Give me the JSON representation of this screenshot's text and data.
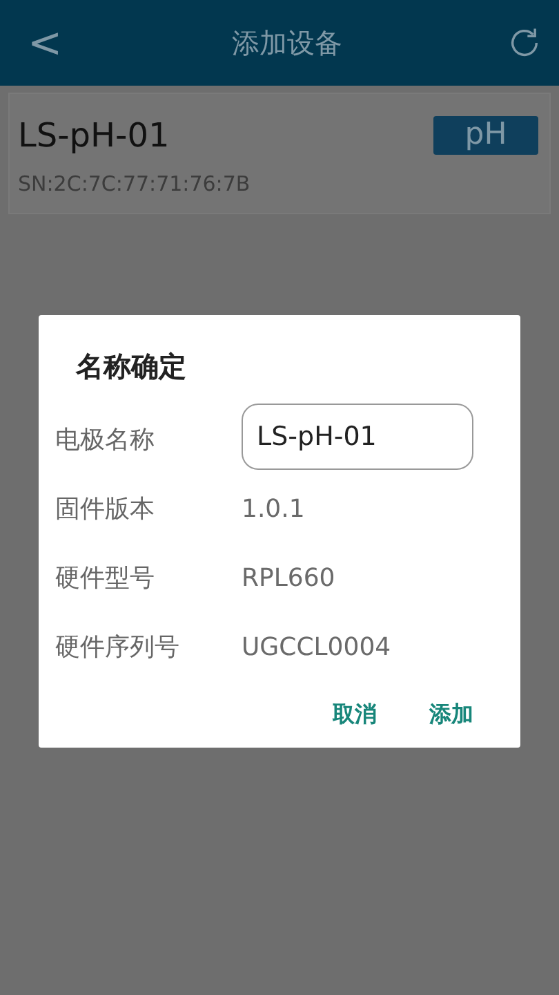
{
  "header": {
    "back": "<",
    "title": "添加设备"
  },
  "device": {
    "name": "LS-pH-01",
    "tag": "pH",
    "serial": "SN:2C:7C:77:71:76:7B"
  },
  "dialog": {
    "title": "名称确定",
    "fields": [
      {
        "label": "电极名称",
        "kind": "input",
        "value": "LS-pH-01"
      },
      {
        "label": "固件版本",
        "kind": "text",
        "value": "1.0.1"
      },
      {
        "label": "硬件型号",
        "kind": "text",
        "value": "RPL660"
      },
      {
        "label": "硬件序列号",
        "kind": "text",
        "value": "UGCCL0004"
      }
    ],
    "buttons": [
      "取消",
      "添加"
    ]
  }
}
